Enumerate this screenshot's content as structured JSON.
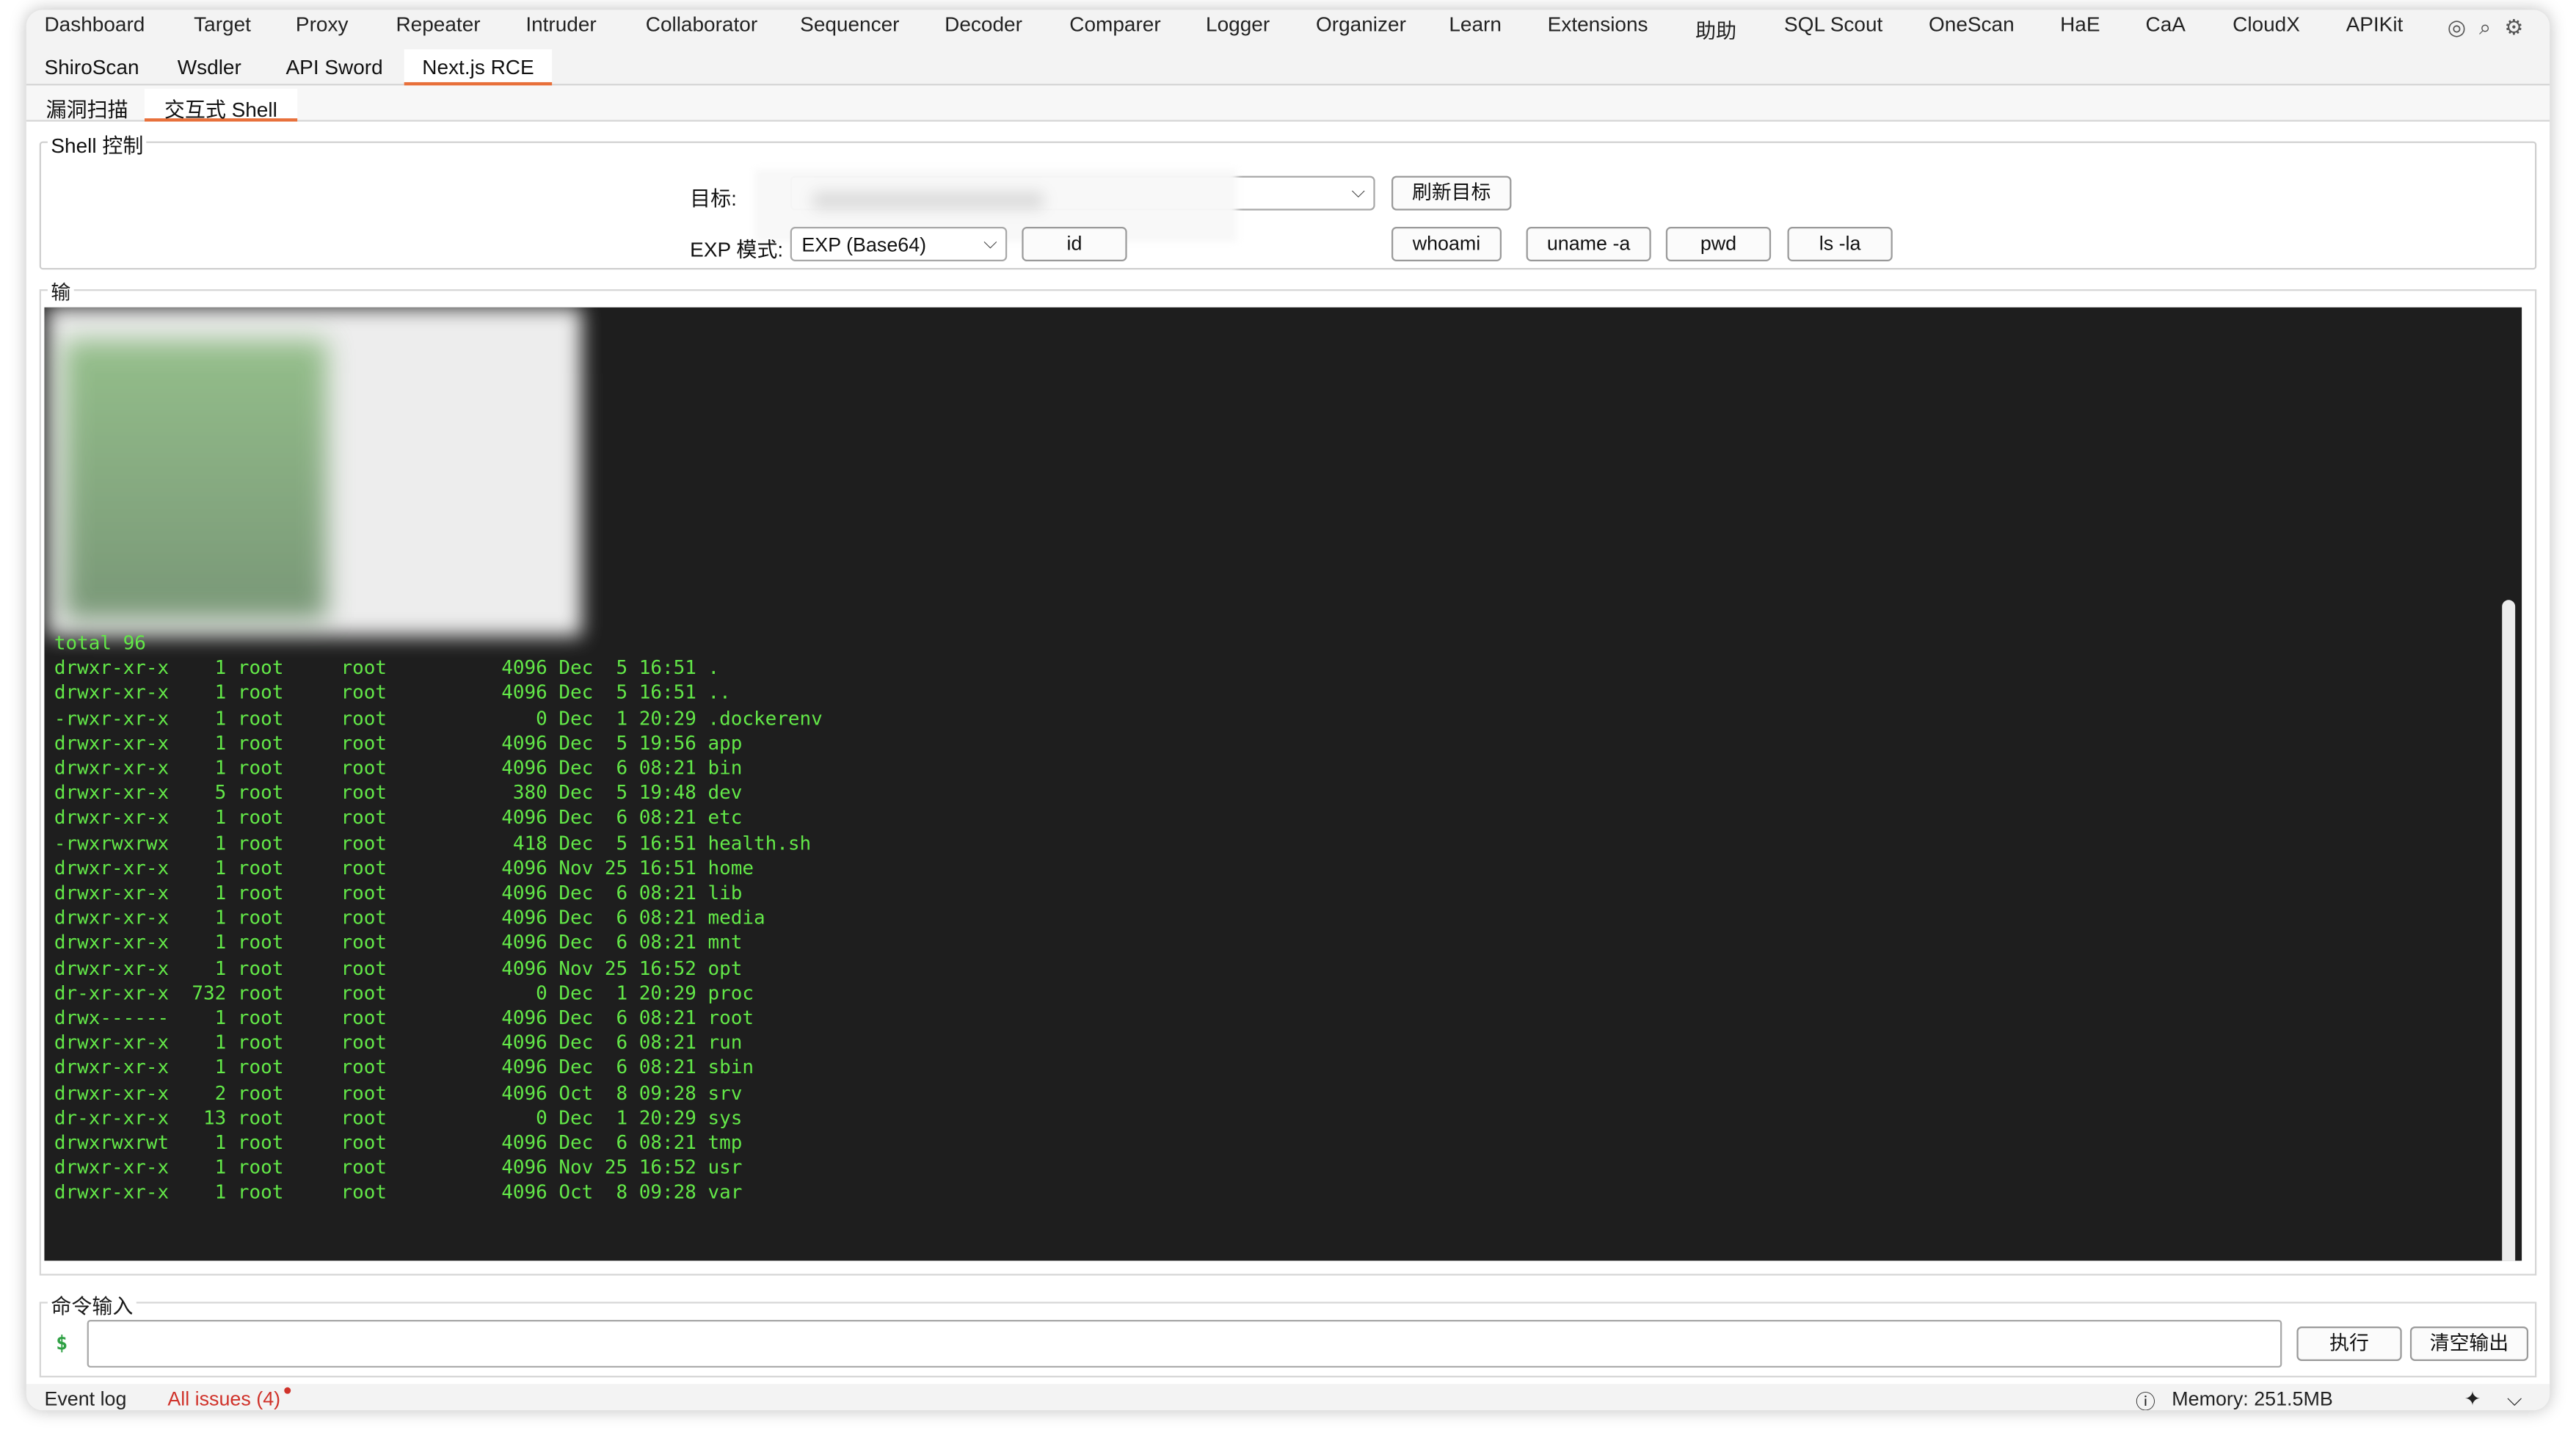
{
  "tool_tabs": [
    "Dashboard",
    "Target",
    "Proxy",
    "Repeater",
    "Intruder",
    "Collaborator",
    "Sequencer",
    "Decoder",
    "Comparer",
    "Logger",
    "Organizer",
    "Learn",
    "Extensions",
    "助助",
    "SQL Scout",
    "OneScan",
    "HaE",
    "CaA",
    "CloudX",
    "APIKit"
  ],
  "ext_tabs": [
    "ShiroScan",
    "Wsdler",
    "API Sword",
    "Next.js RCE"
  ],
  "sub_tabs": [
    "漏洞扫描",
    "交互式 Shell"
  ],
  "shell_control": {
    "title": "Shell 控制",
    "target_label": "目标:",
    "target_value": "",
    "refresh_button": "刷新目标",
    "exp_mode_label": "EXP 模式:",
    "exp_mode_value": "EXP (Base64)",
    "quick_buttons": [
      "id",
      "whoami",
      "uname -a",
      "pwd",
      "ls -la"
    ]
  },
  "output": {
    "title": "输",
    "lines": [
      "total 96",
      "drwxr-xr-x    1 root     root          4096 Dec  5 16:51 .",
      "drwxr-xr-x    1 root     root          4096 Dec  5 16:51 ..",
      "-rwxr-xr-x    1 root     root             0 Dec  1 20:29 .dockerenv",
      "drwxr-xr-x    1 root     root          4096 Dec  5 19:56 app",
      "drwxr-xr-x    1 root     root          4096 Dec  6 08:21 bin",
      "drwxr-xr-x    5 root     root           380 Dec  5 19:48 dev",
      "drwxr-xr-x    1 root     root          4096 Dec  6 08:21 etc",
      "-rwxrwxrwx    1 root     root           418 Dec  5 16:51 health.sh",
      "drwxr-xr-x    1 root     root          4096 Nov 25 16:51 home",
      "drwxr-xr-x    1 root     root          4096 Dec  6 08:21 lib",
      "drwxr-xr-x    1 root     root          4096 Dec  6 08:21 media",
      "drwxr-xr-x    1 root     root          4096 Dec  6 08:21 mnt",
      "drwxr-xr-x    1 root     root          4096 Nov 25 16:52 opt",
      "dr-xr-xr-x  732 root     root             0 Dec  1 20:29 proc",
      "drwx------    1 root     root          4096 Dec  6 08:21 root",
      "drwxr-xr-x    1 root     root          4096 Dec  6 08:21 run",
      "drwxr-xr-x    1 root     root          4096 Dec  6 08:21 sbin",
      "drwxr-xr-x    2 root     root          4096 Oct  8 09:28 srv",
      "dr-xr-xr-x   13 root     root             0 Dec  1 20:29 sys",
      "drwxrwxrwt    1 root     root          4096 Dec  6 08:21 tmp",
      "drwxr-xr-x    1 root     root          4096 Nov 25 16:52 usr",
      "drwxr-xr-x    1 root     root          4096 Oct  8 09:28 var"
    ]
  },
  "command": {
    "title": "命令输入",
    "prompt": "$",
    "value": "",
    "execute_button": "执行",
    "clear_button": "清空输出"
  },
  "status_bar": {
    "event_log": "Event log",
    "all_issues": "All issues (4)",
    "memory": "Memory: 251.5MB"
  },
  "colors": {
    "accent_tab": "#e8703a",
    "terminal_bg": "#1e1e1e",
    "terminal_fg": "#63e848",
    "issues": "#d0322a"
  }
}
